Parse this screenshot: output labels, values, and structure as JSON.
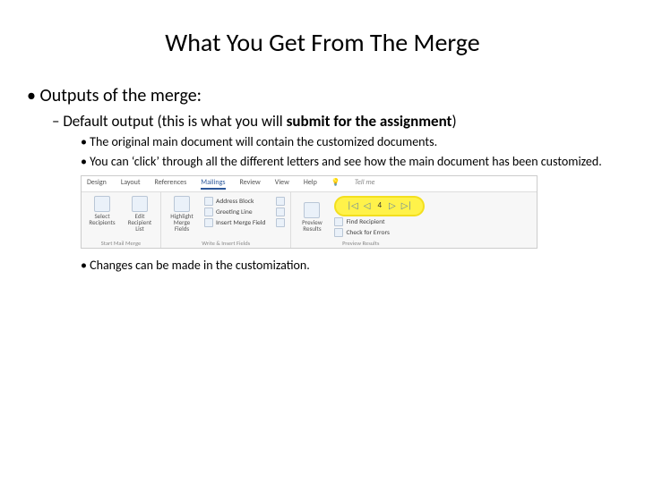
{
  "title": "What You Get From The Merge",
  "lvl1": "Outputs of the merge:",
  "lvl2_prefix": "Default output (this is what you will ",
  "lvl2_bold": "submit for the assignment",
  "lvl2_suffix": ")",
  "lvl3a": "The original main document will contain the customized documents.",
  "lvl3b": "You can ‘click’ through all the different letters and see how the main document has been customized.",
  "lvl3c": "Changes can be made in the customization.",
  "ribbon": {
    "tabs": [
      "Design",
      "Layout",
      "References",
      "Mailings",
      "Review",
      "View",
      "Help"
    ],
    "tellme": "Tell me",
    "group1": {
      "btnA": "Select Recipients",
      "btnB": "Edit Recipient List",
      "label": "Start Mail Merge"
    },
    "group2": {
      "btnA": "Highlight Merge Fields",
      "ab": "Address Block",
      "gl": "Greeting Line",
      "im": "Insert Merge Field",
      "label": "Write & Insert Fields"
    },
    "group3": {
      "btnA": "Preview Results",
      "fr": "Find Recipient",
      "ce": "Check for Errors",
      "count": "4",
      "label": "Preview Results"
    }
  }
}
